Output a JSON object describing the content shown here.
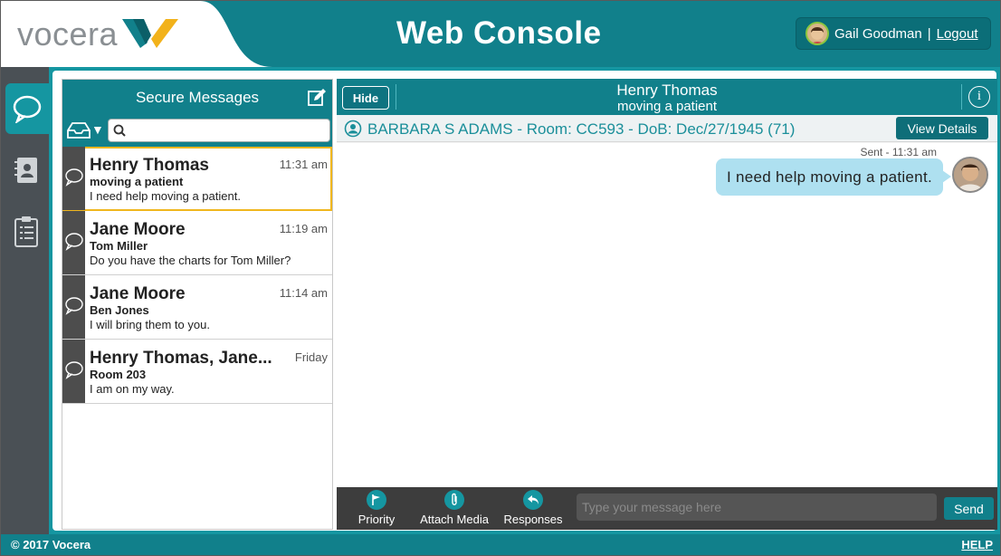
{
  "header": {
    "logo_text": "vocera",
    "title": "Web Console",
    "user_name": "Gail Goodman",
    "separator": "|",
    "logout_label": "Logout"
  },
  "rail": {
    "items": [
      {
        "name": "messages",
        "icon": "chat-bubble-icon",
        "active": true
      },
      {
        "name": "contacts",
        "icon": "contacts-book-icon",
        "active": false
      },
      {
        "name": "tasks",
        "icon": "clipboard-icon",
        "active": false
      }
    ]
  },
  "messages_panel": {
    "title": "Secure Messages",
    "search_placeholder": "",
    "items": [
      {
        "sender": "Henry Thomas",
        "time": "11:31 am",
        "subject": "moving a patient",
        "preview": "I need help moving a patient.",
        "selected": true
      },
      {
        "sender": "Jane Moore",
        "time": "11:19 am",
        "subject": "Tom Miller",
        "preview": "Do you have the charts for Tom Miller?",
        "selected": false
      },
      {
        "sender": "Jane Moore",
        "time": "11:14 am",
        "subject": "Ben Jones",
        "preview": "I will bring them to you.",
        "selected": false
      },
      {
        "sender": "Henry Thomas, Jane...",
        "time": "Friday",
        "subject": "Room 203",
        "preview": "I am on my way.",
        "selected": false
      }
    ]
  },
  "conversation": {
    "hide_label": "Hide",
    "title": "Henry Thomas",
    "subtitle": "moving a patient",
    "info_label": "i",
    "patient_info": "BARBARA S ADAMS - Room: CC593 - DoB: Dec/27/1945 (71)",
    "view_details_label": "View Details",
    "messages": [
      {
        "status": "Sent - 11:31 am",
        "text": "I need help moving a patient."
      }
    ],
    "tools": [
      {
        "label": "Priority",
        "icon": "flag-icon"
      },
      {
        "label": "Attach Media",
        "icon": "paperclip-icon"
      },
      {
        "label": "Responses",
        "icon": "reply-arrow-icon"
      }
    ],
    "input_placeholder": "Type your message here",
    "send_label": "Send"
  },
  "footer": {
    "copyright": "© 2017 Vocera",
    "help_label": "HELP"
  },
  "colors": {
    "teal": "#11808b",
    "teal_light": "#1596a1",
    "selected_border": "#f0b71e",
    "bubble": "#aee0f0",
    "rail": "#4a5055"
  }
}
